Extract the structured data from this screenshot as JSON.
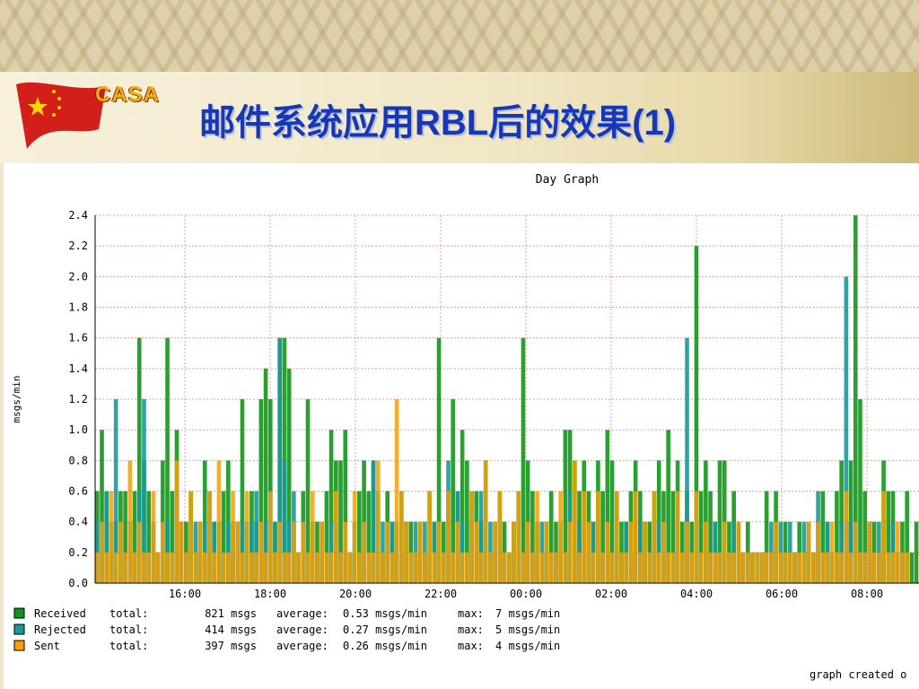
{
  "header": {
    "logo_text": "CASA",
    "title": "邮件系统应用RBL后的效果(1)"
  },
  "colors": {
    "received": "#12961a",
    "rejected": "#1a9a9a",
    "sent": "#f5a000",
    "grid": "#e6a0a0",
    "title_blue": "#1638b8"
  },
  "chart_data": {
    "type": "bar",
    "title": "Day Graph",
    "ylabel": "msgs/min",
    "ylim": [
      0,
      2.4
    ],
    "yticks": [
      "0.0",
      "0.2",
      "0.4",
      "0.6",
      "0.8",
      "1.0",
      "1.2",
      "1.4",
      "1.6",
      "1.8",
      "2.0",
      "2.2",
      "2.4"
    ],
    "xticks": [
      "16:00",
      "18:00",
      "20:00",
      "22:00",
      "00:00",
      "02:00",
      "04:00",
      "06:00",
      "08:00"
    ],
    "series": [
      {
        "name": "Received",
        "values": [
          0.6,
          1.0,
          0.6,
          0.2,
          0.4,
          0.6,
          0.6,
          0.4,
          0.6,
          1.6,
          0.8,
          0.6,
          0.4,
          0.2,
          0.8,
          1.6,
          0.6,
          1.0,
          0.4,
          0.4,
          0.6,
          0.2,
          0.4,
          0.8,
          0.6,
          0.4,
          0.4,
          0.6,
          0.8,
          0.4,
          0.2,
          1.2,
          0.4,
          0.6,
          0.4,
          1.2,
          1.4,
          1.2,
          0.4,
          1.6,
          1.6,
          1.4,
          0.4,
          0.2,
          0.6,
          1.2,
          0.4,
          0.4,
          0.2,
          0.6,
          1.0,
          0.8,
          0.8,
          1.0,
          0.2,
          0.4,
          0.6,
          0.8,
          0.6,
          0.8,
          0.6,
          0.2,
          0.6,
          0.4,
          0.4,
          0.6,
          0.4,
          0.4,
          0.2,
          0.4,
          0.2,
          0.6,
          0.4,
          1.6,
          0.4,
          0.6,
          1.2,
          0.6,
          1.0,
          0.8,
          0.6,
          0.6,
          0.4,
          0.8,
          0.2,
          0.4,
          0.6,
          0.4,
          0.2,
          0.4,
          0.6,
          1.6,
          0.8,
          0.6,
          0.4,
          0.2,
          0.4,
          0.6,
          0.4,
          0.2,
          1.0,
          1.0,
          0.8,
          0.6,
          0.8,
          0.6,
          0.4,
          0.8,
          0.6,
          1.0,
          0.8,
          0.6,
          0.4,
          0.4,
          0.6,
          0.8,
          0.6,
          0.4,
          0.4,
          0.6,
          0.8,
          0.6,
          1.0,
          0.6,
          0.8,
          0.4,
          0.6,
          0.4,
          2.2,
          0.6,
          0.8,
          0.6,
          0.4,
          0.8,
          0.8,
          0.4,
          0.6,
          0.4,
          0.2,
          0.4,
          0.2,
          0.2,
          0.2,
          0.6,
          0.2,
          0.6,
          0.2,
          0.4,
          0.2,
          0.2,
          0.4,
          0.2,
          0.2,
          0.2,
          0.4,
          0.6,
          0.4,
          0.2,
          0.6,
          0.8,
          0.4,
          0.8,
          2.4,
          1.2,
          0.6,
          0.4,
          0.4,
          0.2,
          0.8,
          0.6,
          0.6,
          0.2,
          0.4,
          0.6,
          0.2,
          0.4
        ]
      },
      {
        "name": "Rejected",
        "values": [
          0.4,
          0.2,
          0.6,
          0.4,
          1.2,
          0.4,
          0.2,
          0.4,
          0.2,
          0.6,
          1.2,
          0.2,
          0.4,
          0.2,
          0.4,
          0.4,
          0.2,
          0.6,
          0.4,
          0.2,
          0.4,
          0.4,
          0.2,
          0.4,
          0.2,
          0.4,
          0.2,
          0.2,
          0.4,
          0.2,
          0.4,
          0.4,
          0.2,
          0.4,
          0.6,
          0.2,
          0.4,
          0.6,
          0.4,
          1.6,
          0.8,
          0.4,
          0.6,
          0.2,
          0.4,
          0.2,
          0.4,
          0.2,
          0.4,
          0.2,
          0.4,
          0.4,
          0.2,
          0.4,
          0.2,
          0.4,
          0.2,
          0.4,
          0.2,
          0.8,
          0.2,
          0.4,
          0.2,
          0.4,
          0.2,
          0.2,
          0.4,
          0.2,
          0.4,
          0.2,
          0.4,
          0.2,
          0.4,
          0.2,
          0.2,
          0.8,
          0.2,
          0.6,
          0.4,
          0.2,
          0.4,
          0.2,
          0.6,
          0.2,
          0.4,
          0.2,
          0.4,
          0.2,
          0.2,
          0.4,
          0.2,
          0.2,
          0.4,
          0.2,
          0.2,
          0.4,
          0.2,
          0.2,
          0.2,
          0.4,
          0.2,
          0.6,
          0.2,
          0.4,
          0.2,
          0.2,
          0.4,
          0.2,
          0.2,
          0.4,
          0.2,
          0.2,
          0.2,
          0.4,
          0.2,
          0.2,
          0.4,
          0.2,
          0.2,
          0.2,
          0.4,
          0.2,
          0.2,
          0.2,
          0.4,
          0.2,
          1.6,
          0.2,
          0.4,
          0.2,
          0.2,
          0.2,
          0.4,
          0.2,
          0.2,
          0.2,
          0.4,
          0.2,
          0.2,
          0.2,
          0.2,
          0.2,
          0.2,
          0.2,
          0.4,
          0.2,
          0.4,
          0.2,
          0.4,
          0.2,
          0.2,
          0.4,
          0.4,
          0.2,
          0.6,
          0.2,
          0.4,
          0.2,
          0.2,
          0.4,
          2.0,
          0.4,
          0.4,
          0.2,
          0.2,
          0.4,
          0.2,
          0.4,
          0.2,
          0.2,
          0.4,
          0.2,
          0.2
        ]
      },
      {
        "name": "Sent",
        "values": [
          0.2,
          0.4,
          0.2,
          0.6,
          0.2,
          0.4,
          0.2,
          0.8,
          0.2,
          0.4,
          0.2,
          0.2,
          0.6,
          0.2,
          0.4,
          0.2,
          0.2,
          0.8,
          0.4,
          0.2,
          0.6,
          0.2,
          0.4,
          0.2,
          0.6,
          0.2,
          0.8,
          0.2,
          0.2,
          0.6,
          0.4,
          0.2,
          0.6,
          0.2,
          0.2,
          0.4,
          0.2,
          0.6,
          0.2,
          0.4,
          0.2,
          0.2,
          0.4,
          0.2,
          0.4,
          0.2,
          0.6,
          0.2,
          0.4,
          0.2,
          0.2,
          0.6,
          0.2,
          0.4,
          0.2,
          0.6,
          0.2,
          0.4,
          0.2,
          0.2,
          0.8,
          0.2,
          0.4,
          0.2,
          1.2,
          0.6,
          0.4,
          0.2,
          0.2,
          0.4,
          0.2,
          0.6,
          0.2,
          0.4,
          0.2,
          0.6,
          0.2,
          0.4,
          0.2,
          0.2,
          0.6,
          0.4,
          0.2,
          0.8,
          0.2,
          0.4,
          0.6,
          0.2,
          0.2,
          0.4,
          0.6,
          0.2,
          0.4,
          0.2,
          0.6,
          0.2,
          0.4,
          0.2,
          0.2,
          0.6,
          0.2,
          0.4,
          0.8,
          0.2,
          0.6,
          0.4,
          0.2,
          0.6,
          0.2,
          0.4,
          0.2,
          0.6,
          0.2,
          0.2,
          0.4,
          0.6,
          0.2,
          0.4,
          0.2,
          0.6,
          0.2,
          0.4,
          0.2,
          0.2,
          0.6,
          0.2,
          0.4,
          0.2,
          0.6,
          0.2,
          0.4,
          0.2,
          0.2,
          0.2,
          0.4,
          0.2,
          0.2,
          0.4,
          0.2,
          0.2,
          0.2,
          0.2,
          0.2,
          0.2,
          0.2,
          0.4,
          0.2,
          0.2,
          0.2,
          0.2,
          0.2,
          0.2,
          0.4,
          0.2,
          0.4,
          0.2,
          0.2,
          0.4,
          0.2,
          0.2,
          0.6,
          0.2,
          0.4,
          0.2,
          0.2,
          0.4,
          0.2,
          0.2,
          0.6,
          0.2,
          0.2,
          0.4,
          0.2,
          0.2
        ]
      }
    ],
    "legend": [
      {
        "name": "Received",
        "total": "821 msgs",
        "average": "0.53 msgs/min",
        "max": "7 msgs/min"
      },
      {
        "name": "Rejected",
        "total": "414 msgs",
        "average": "0.27 msgs/min",
        "max": "5 msgs/min"
      },
      {
        "name": "Sent",
        "total": "397 msgs",
        "average": "0.26 msgs/min",
        "max": "4 msgs/min"
      }
    ],
    "legend_labels": {
      "total": "total:",
      "average": "average:",
      "max": "max:"
    },
    "footer": "graph created o",
    "grid": true
  }
}
